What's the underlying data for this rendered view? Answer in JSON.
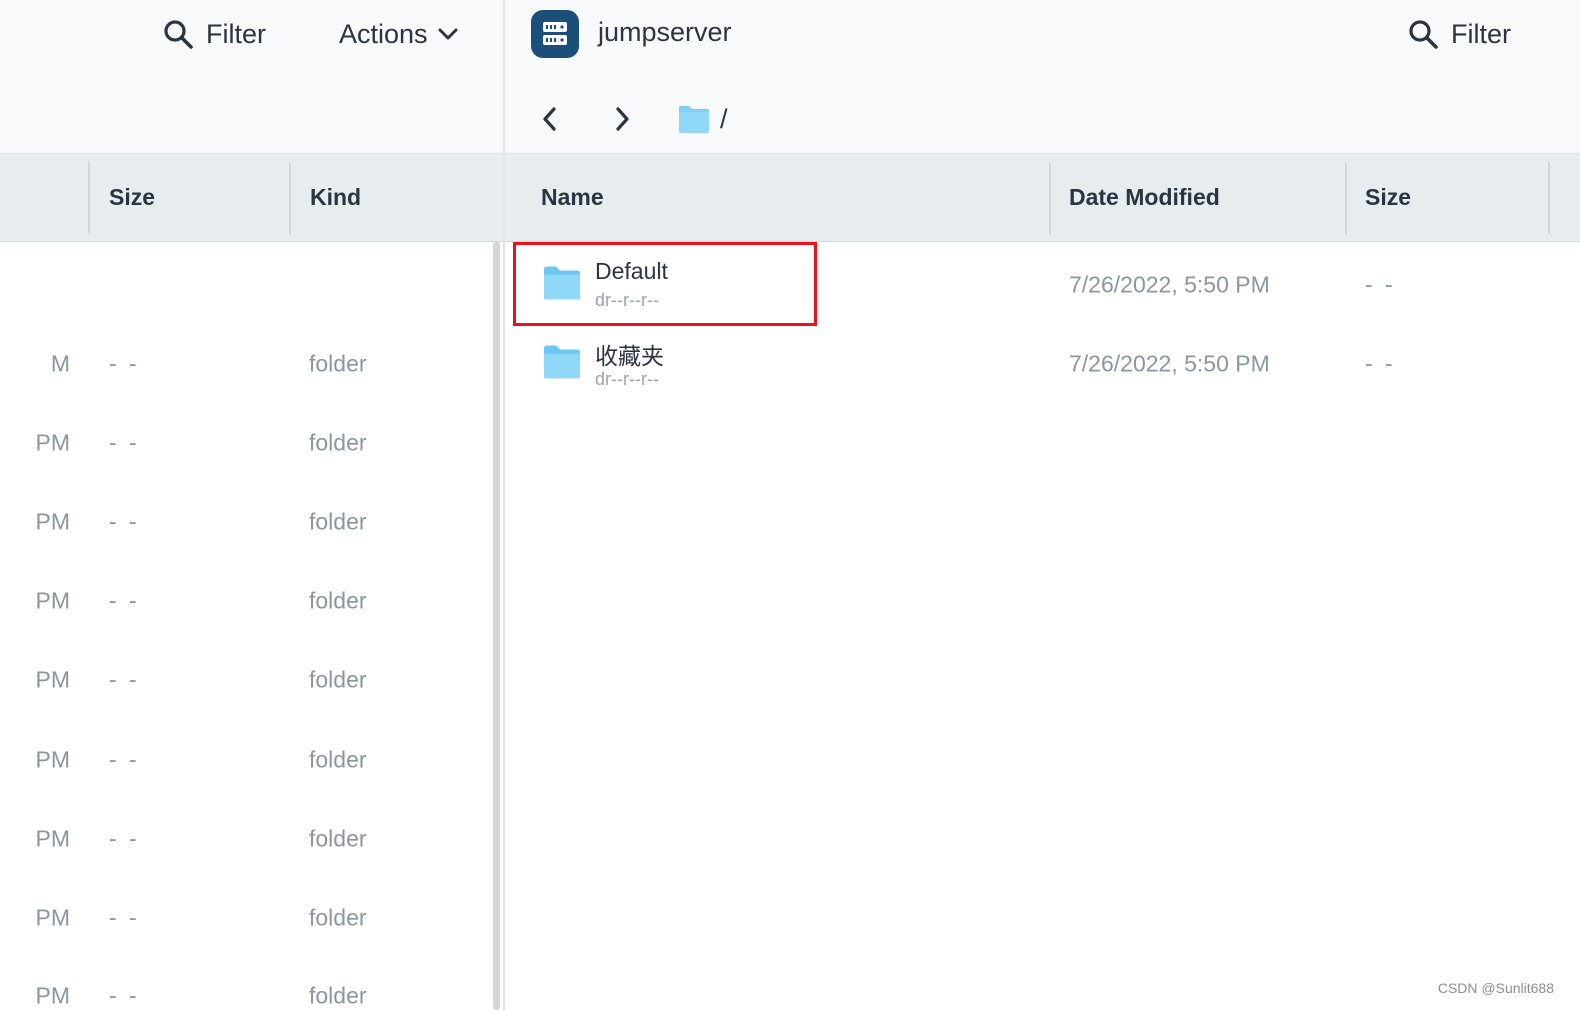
{
  "left_pane": {
    "toolbar": {
      "filter_label": "Filter",
      "actions_label": "Actions",
      "filter_icon": "search-icon",
      "actions_icon": "chevron-down-icon"
    },
    "columns": [
      "Size",
      "Kind"
    ],
    "rows": [
      {
        "date": "M",
        "size": "- -",
        "kind": "folder"
      },
      {
        "date": "PM",
        "size": "- -",
        "kind": "folder"
      },
      {
        "date": "PM",
        "size": "- -",
        "kind": "folder"
      },
      {
        "date": "PM",
        "size": "- -",
        "kind": "folder"
      },
      {
        "date": "PM",
        "size": "- -",
        "kind": "folder"
      },
      {
        "date": "PM",
        "size": "- -",
        "kind": "folder"
      },
      {
        "date": "PM",
        "size": "- -",
        "kind": "folder"
      },
      {
        "date": "PM",
        "size": "- -",
        "kind": "folder"
      },
      {
        "date": "PM",
        "size": "- -",
        "kind": "folder"
      }
    ]
  },
  "right_pane": {
    "server_name": "jumpserver",
    "server_icon": "server-icon",
    "filter_label": "Filter",
    "path": "/",
    "columns": [
      "Name",
      "Date Modified",
      "Size"
    ],
    "files": [
      {
        "name": "Default",
        "permissions": "dr--r--r--",
        "date_modified": "7/26/2022, 5:50 PM",
        "size": "- -",
        "highlighted": true
      },
      {
        "name": "收藏夹",
        "permissions": "dr--r--r--",
        "date_modified": "7/26/2022, 5:50 PM",
        "size": "- -",
        "highlighted": false
      }
    ]
  },
  "watermark": "CSDN @Sunlit688",
  "colors": {
    "accent_folder": "#7fd0f5",
    "server_badge": "#1b4f7a",
    "highlight": "#e8131b",
    "header_bg": "#e7ecef",
    "toolbar_bg": "#f7f9fb"
  }
}
